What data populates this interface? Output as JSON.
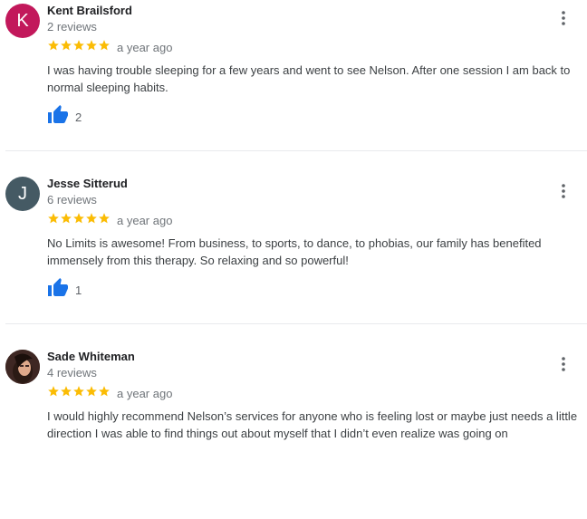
{
  "colors": {
    "star": "#fbbc04",
    "like": "#1a73e8"
  },
  "reviews": [
    {
      "initial": "K",
      "avatar_color": "#c2185b",
      "name": "Kent Brailsford",
      "review_count": "2 reviews",
      "rating": 5,
      "age": "a year ago",
      "text": "I was having trouble sleeping for a few years and went to see Nelson. After one session I am back to normal sleeping habits.",
      "likes": "2"
    },
    {
      "initial": "J",
      "avatar_color": "#455a64",
      "name": "Jesse Sitterud",
      "review_count": "6 reviews",
      "rating": 5,
      "age": "a year ago",
      "text": "No Limits is awesome! From business, to sports, to dance, to phobias, our family has benefited immensely from this therapy. So relaxing and so powerful!",
      "likes": "1"
    },
    {
      "initial": "",
      "avatar_color": "#5d4037",
      "name": "Sade Whiteman",
      "review_count": "4 reviews",
      "rating": 5,
      "age": "a year ago",
      "text": "I would highly recommend Nelson’s services for anyone who is feeling lost or maybe just needs a little direction I was able to find things out about myself that I didn’t even realize was going on",
      "likes": ""
    }
  ]
}
